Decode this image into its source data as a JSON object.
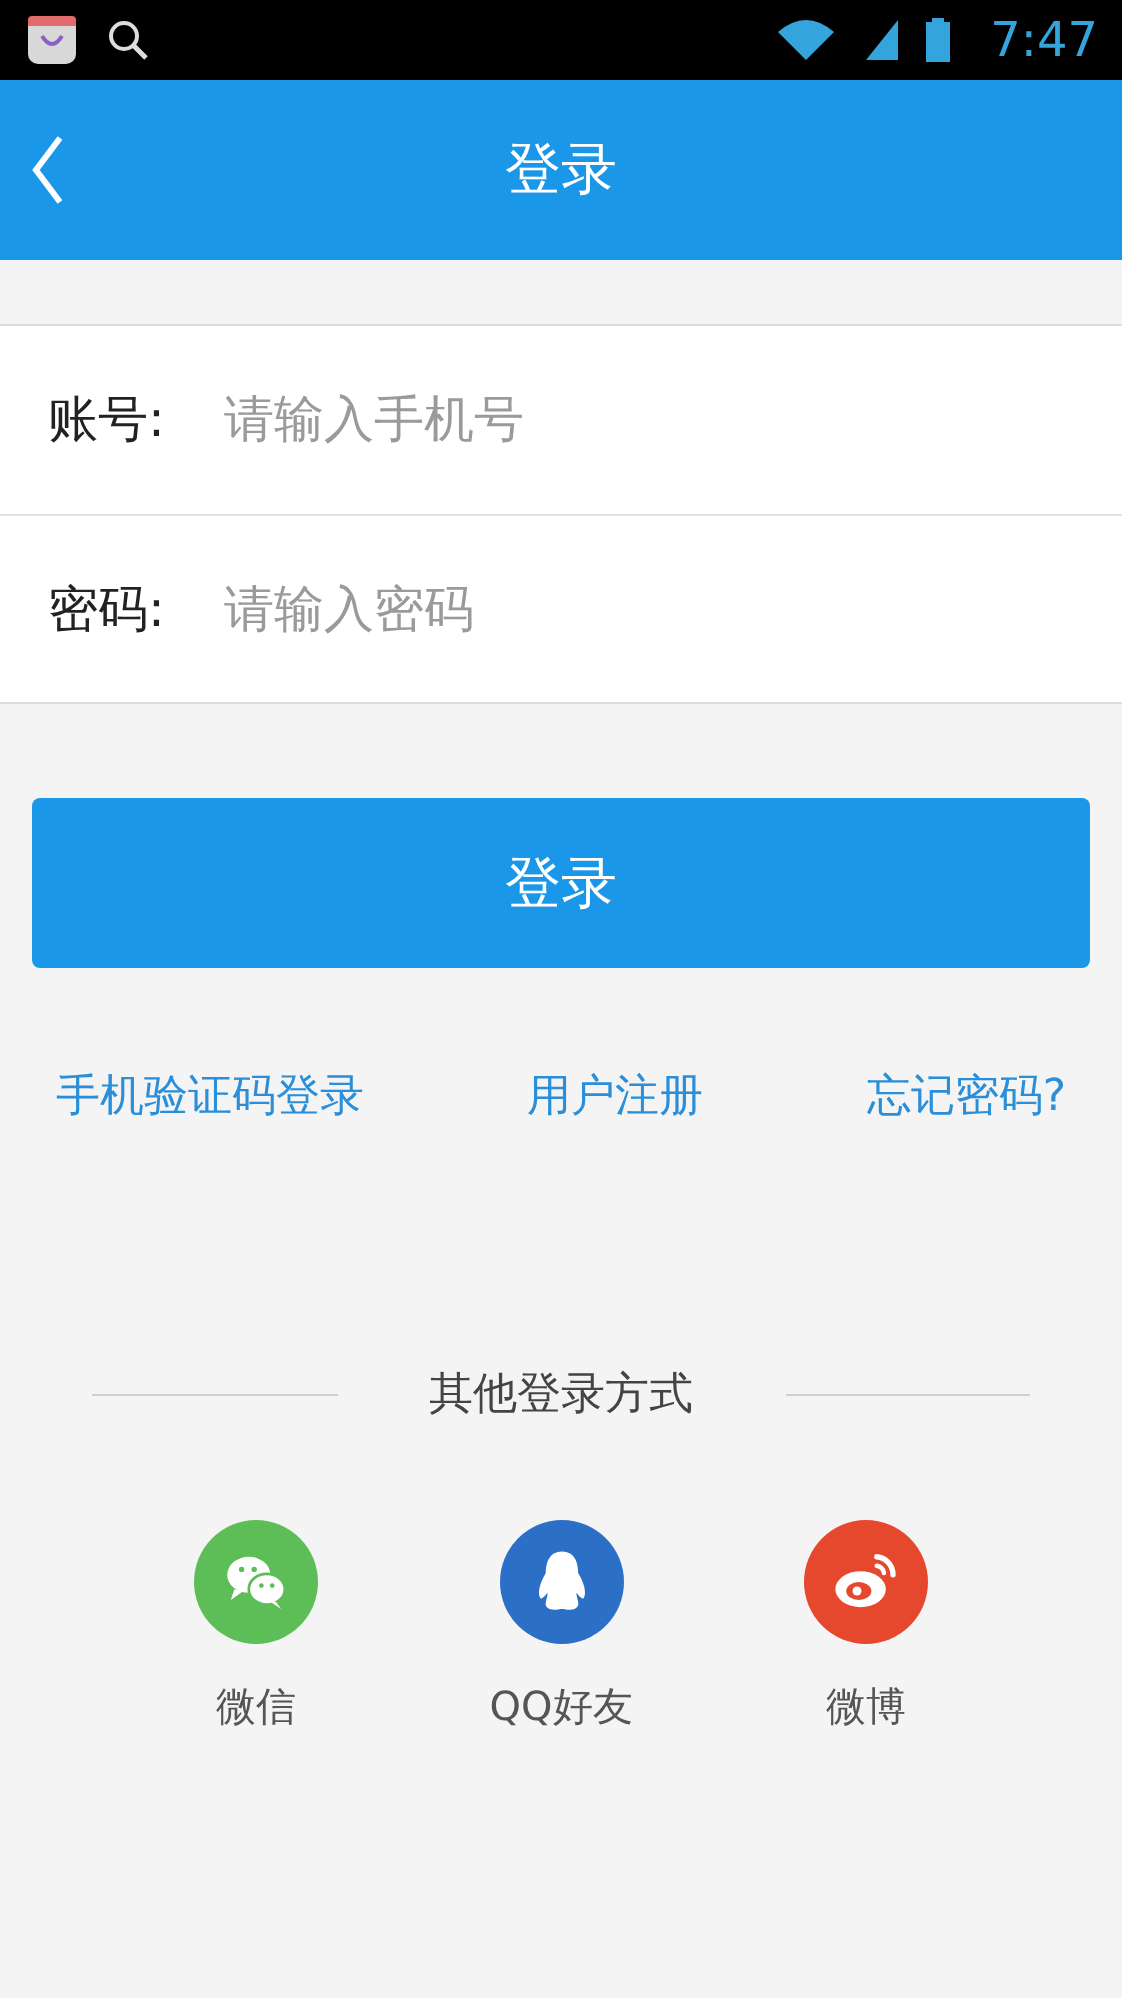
{
  "status_bar": {
    "time": "7:47"
  },
  "header": {
    "title": "登录"
  },
  "form": {
    "fields": [
      {
        "label": "账号:",
        "placeholder": "请输入手机号"
      },
      {
        "label": "密码:",
        "placeholder": "请输入密码"
      }
    ]
  },
  "login_button": "登录",
  "links": [
    "手机验证码登录",
    "用户注册",
    "忘记密码?"
  ],
  "other_login": {
    "title": "其他登录方式",
    "options": [
      {
        "label": "微信",
        "kind": "wechat",
        "color": "#5dbe57"
      },
      {
        "label": "QQ好友",
        "kind": "qq",
        "color": "#2b6fc6"
      },
      {
        "label": "微博",
        "kind": "weibo",
        "color": "#e5482d"
      }
    ]
  }
}
